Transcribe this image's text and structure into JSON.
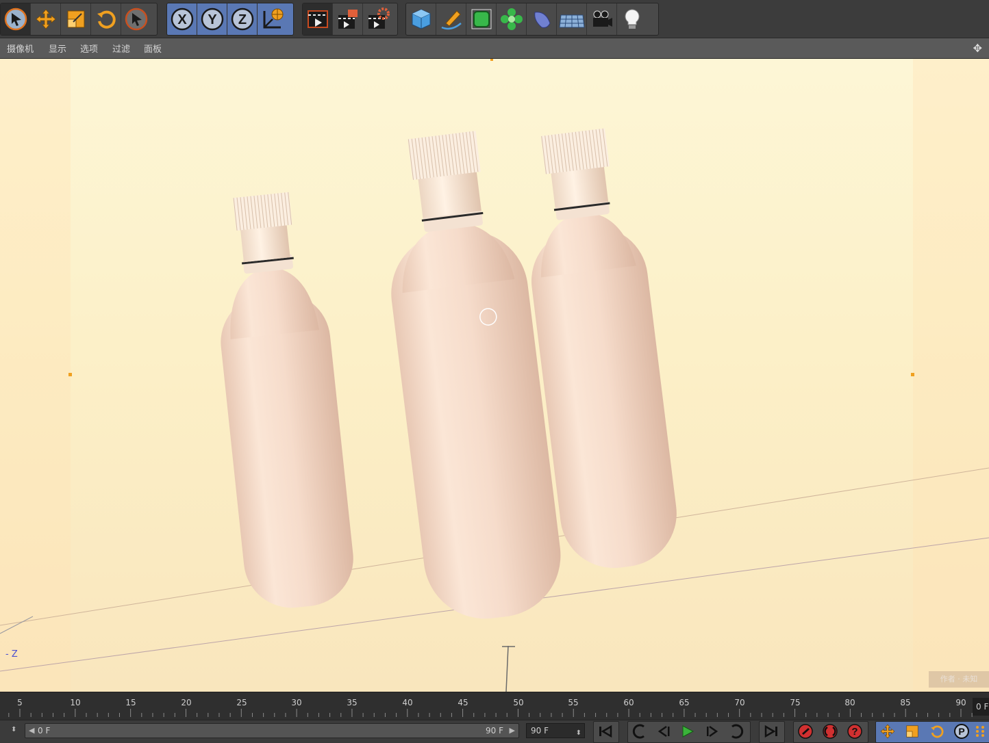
{
  "menubar": {
    "items": [
      "摄像机",
      "显示",
      "选项",
      "过滤",
      "面板"
    ]
  },
  "toolbar": {
    "groups": [
      [
        "live-selection-icon",
        "move-icon",
        "scale-icon",
        "rotate-icon",
        "last-tool-icon"
      ],
      [
        "x-axis-icon",
        "y-axis-icon",
        "z-axis-icon",
        "world-coordinates-icon"
      ],
      [
        "render-view-icon",
        "render-to-picture-viewer-icon",
        "render-settings-icon"
      ],
      [
        "cube-icon",
        "pen-icon",
        "subdivision-icon",
        "cloner-icon",
        "bend-deformer-icon",
        "floor-icon",
        "camera-icon",
        "light-icon"
      ]
    ]
  },
  "viewport": {
    "axis_label": "Z",
    "watermark": "作者 · 未知"
  },
  "timeline": {
    "ticks": [
      "5",
      "10",
      "15",
      "20",
      "25",
      "30",
      "35",
      "40",
      "45",
      "50",
      "55",
      "60",
      "65",
      "70",
      "75",
      "80",
      "85",
      "90"
    ],
    "current_frame": "0 F"
  },
  "transport": {
    "range_start": "0 F",
    "range_end": "90 F",
    "end_frame": "90 F"
  },
  "colors": {
    "accent_orange": "#f0a020",
    "viewport_bg": "#fcf0c8",
    "bottle": "#f5dccb"
  }
}
